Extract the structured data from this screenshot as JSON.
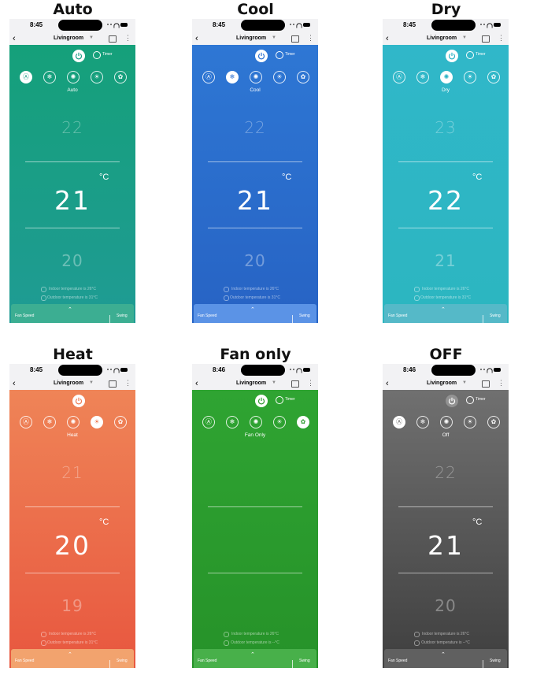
{
  "colors": {
    "auto": "#1a9e86",
    "cool": "#2a6fd0",
    "dry": "#2bb3c5",
    "heat": "#ee7a52",
    "fan": "#2c9b2e",
    "off": "#6a6a6a"
  },
  "icons": [
    "auto-mode-icon",
    "snowflake-icon",
    "drop-icon",
    "sun-icon",
    "fan-icon",
    "power-icon",
    "alarm-clock-icon",
    "back-chevron-icon",
    "calendar-icon",
    "more-icon",
    "fan-speed-bars-icon",
    "swing-icon"
  ],
  "panels": [
    {
      "caption": "Auto",
      "time": "8:45",
      "room": "Livingroom",
      "timer": "Timer",
      "mode": "Auto",
      "selected": 0,
      "t_up": "22",
      "t_cur": "21",
      "t_down": "20",
      "unit": "°C",
      "indoor": "Indoor temperature is 26°C",
      "outdoor": "Outdoor temperature is 31°C",
      "fan_speed_label": "Fan Speed",
      "fan_speed_value": "AUTO",
      "swing_label": "Swing",
      "show_timer": true
    },
    {
      "caption": "Cool",
      "time": "8:45",
      "room": "Livingroom",
      "timer": "Timer",
      "mode": "Cool",
      "selected": 1,
      "t_up": "22",
      "t_cur": "21",
      "t_down": "20",
      "unit": "°C",
      "indoor": "Indoor temperature is 26°C",
      "outdoor": "Outdoor temperature is 31°C",
      "fan_speed_label": "Fan Speed",
      "fan_speed_value": "AUTO",
      "swing_label": "Swing",
      "show_timer": true
    },
    {
      "caption": "Dry",
      "time": "8:45",
      "room": "Livingroom",
      "timer": "Timer",
      "mode": "Dry",
      "selected": 2,
      "t_up": "23",
      "t_cur": "22",
      "t_down": "21",
      "unit": "°C",
      "indoor": "Indoor temperature is 26°C",
      "outdoor": "Outdoor temperature is 31°C",
      "fan_speed_label": "Fan Speed",
      "fan_speed_value": "AUTO",
      "swing_label": "Swing",
      "show_timer": true
    },
    {
      "caption": "Heat",
      "time": "8:45",
      "room": "Livingroom",
      "timer": "Timer",
      "mode": "Heat",
      "selected": 3,
      "t_up": "21",
      "t_cur": "20",
      "t_down": "19",
      "unit": "°C",
      "indoor": "Indoor temperature is 26°C",
      "outdoor": "Outdoor temperature is 31°C",
      "fan_speed_label": "Fan Speed",
      "fan_speed_value": "AUTO",
      "swing_label": "Swing",
      "show_timer": false
    },
    {
      "caption": "Fan only",
      "time": "8:46",
      "room": "Livingroom",
      "timer": "Timer",
      "mode": "Fan Only",
      "selected": 4,
      "t_up": "",
      "t_cur": "",
      "t_down": "",
      "unit": "",
      "indoor": "Indoor temperature is 26°C",
      "outdoor": "Outdoor temperature is --°C",
      "fan_speed_label": "Fan Speed",
      "fan_speed_value": "AUTO",
      "swing_label": "Swing",
      "show_timer": true
    },
    {
      "caption": "OFF",
      "time": "8:46",
      "room": "Livingroom",
      "timer": "Timer",
      "mode": "Off",
      "selected": 0,
      "t_up": "22",
      "t_cur": "21",
      "t_down": "20",
      "unit": "°C",
      "indoor": "Indoor temperature is 26°C",
      "outdoor": "Outdoor temperature is --°C",
      "fan_speed_label": "Fan Speed",
      "fan_speed_value": "AUTO",
      "swing_label": "Swing",
      "show_timer": true
    }
  ]
}
